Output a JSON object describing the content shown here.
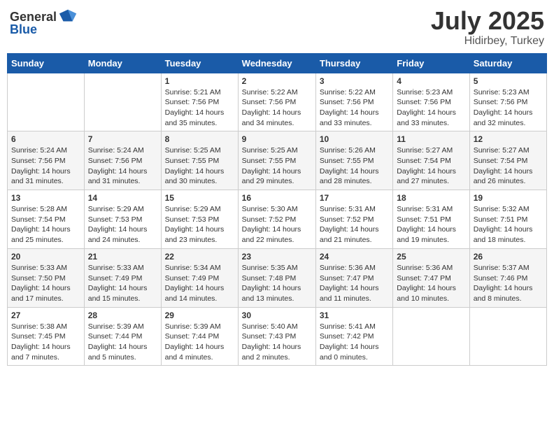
{
  "header": {
    "logo_general": "General",
    "logo_blue": "Blue",
    "month": "July 2025",
    "location": "Hidirbey, Turkey"
  },
  "weekdays": [
    "Sunday",
    "Monday",
    "Tuesday",
    "Wednesday",
    "Thursday",
    "Friday",
    "Saturday"
  ],
  "weeks": [
    [
      {
        "day": "",
        "info": ""
      },
      {
        "day": "",
        "info": ""
      },
      {
        "day": "1",
        "info": "Sunrise: 5:21 AM\nSunset: 7:56 PM\nDaylight: 14 hours and 35 minutes."
      },
      {
        "day": "2",
        "info": "Sunrise: 5:22 AM\nSunset: 7:56 PM\nDaylight: 14 hours and 34 minutes."
      },
      {
        "day": "3",
        "info": "Sunrise: 5:22 AM\nSunset: 7:56 PM\nDaylight: 14 hours and 33 minutes."
      },
      {
        "day": "4",
        "info": "Sunrise: 5:23 AM\nSunset: 7:56 PM\nDaylight: 14 hours and 33 minutes."
      },
      {
        "day": "5",
        "info": "Sunrise: 5:23 AM\nSunset: 7:56 PM\nDaylight: 14 hours and 32 minutes."
      }
    ],
    [
      {
        "day": "6",
        "info": "Sunrise: 5:24 AM\nSunset: 7:56 PM\nDaylight: 14 hours and 31 minutes."
      },
      {
        "day": "7",
        "info": "Sunrise: 5:24 AM\nSunset: 7:56 PM\nDaylight: 14 hours and 31 minutes."
      },
      {
        "day": "8",
        "info": "Sunrise: 5:25 AM\nSunset: 7:55 PM\nDaylight: 14 hours and 30 minutes."
      },
      {
        "day": "9",
        "info": "Sunrise: 5:25 AM\nSunset: 7:55 PM\nDaylight: 14 hours and 29 minutes."
      },
      {
        "day": "10",
        "info": "Sunrise: 5:26 AM\nSunset: 7:55 PM\nDaylight: 14 hours and 28 minutes."
      },
      {
        "day": "11",
        "info": "Sunrise: 5:27 AM\nSunset: 7:54 PM\nDaylight: 14 hours and 27 minutes."
      },
      {
        "day": "12",
        "info": "Sunrise: 5:27 AM\nSunset: 7:54 PM\nDaylight: 14 hours and 26 minutes."
      }
    ],
    [
      {
        "day": "13",
        "info": "Sunrise: 5:28 AM\nSunset: 7:54 PM\nDaylight: 14 hours and 25 minutes."
      },
      {
        "day": "14",
        "info": "Sunrise: 5:29 AM\nSunset: 7:53 PM\nDaylight: 14 hours and 24 minutes."
      },
      {
        "day": "15",
        "info": "Sunrise: 5:29 AM\nSunset: 7:53 PM\nDaylight: 14 hours and 23 minutes."
      },
      {
        "day": "16",
        "info": "Sunrise: 5:30 AM\nSunset: 7:52 PM\nDaylight: 14 hours and 22 minutes."
      },
      {
        "day": "17",
        "info": "Sunrise: 5:31 AM\nSunset: 7:52 PM\nDaylight: 14 hours and 21 minutes."
      },
      {
        "day": "18",
        "info": "Sunrise: 5:31 AM\nSunset: 7:51 PM\nDaylight: 14 hours and 19 minutes."
      },
      {
        "day": "19",
        "info": "Sunrise: 5:32 AM\nSunset: 7:51 PM\nDaylight: 14 hours and 18 minutes."
      }
    ],
    [
      {
        "day": "20",
        "info": "Sunrise: 5:33 AM\nSunset: 7:50 PM\nDaylight: 14 hours and 17 minutes."
      },
      {
        "day": "21",
        "info": "Sunrise: 5:33 AM\nSunset: 7:49 PM\nDaylight: 14 hours and 15 minutes."
      },
      {
        "day": "22",
        "info": "Sunrise: 5:34 AM\nSunset: 7:49 PM\nDaylight: 14 hours and 14 minutes."
      },
      {
        "day": "23",
        "info": "Sunrise: 5:35 AM\nSunset: 7:48 PM\nDaylight: 14 hours and 13 minutes."
      },
      {
        "day": "24",
        "info": "Sunrise: 5:36 AM\nSunset: 7:47 PM\nDaylight: 14 hours and 11 minutes."
      },
      {
        "day": "25",
        "info": "Sunrise: 5:36 AM\nSunset: 7:47 PM\nDaylight: 14 hours and 10 minutes."
      },
      {
        "day": "26",
        "info": "Sunrise: 5:37 AM\nSunset: 7:46 PM\nDaylight: 14 hours and 8 minutes."
      }
    ],
    [
      {
        "day": "27",
        "info": "Sunrise: 5:38 AM\nSunset: 7:45 PM\nDaylight: 14 hours and 7 minutes."
      },
      {
        "day": "28",
        "info": "Sunrise: 5:39 AM\nSunset: 7:44 PM\nDaylight: 14 hours and 5 minutes."
      },
      {
        "day": "29",
        "info": "Sunrise: 5:39 AM\nSunset: 7:44 PM\nDaylight: 14 hours and 4 minutes."
      },
      {
        "day": "30",
        "info": "Sunrise: 5:40 AM\nSunset: 7:43 PM\nDaylight: 14 hours and 2 minutes."
      },
      {
        "day": "31",
        "info": "Sunrise: 5:41 AM\nSunset: 7:42 PM\nDaylight: 14 hours and 0 minutes."
      },
      {
        "day": "",
        "info": ""
      },
      {
        "day": "",
        "info": ""
      }
    ]
  ]
}
